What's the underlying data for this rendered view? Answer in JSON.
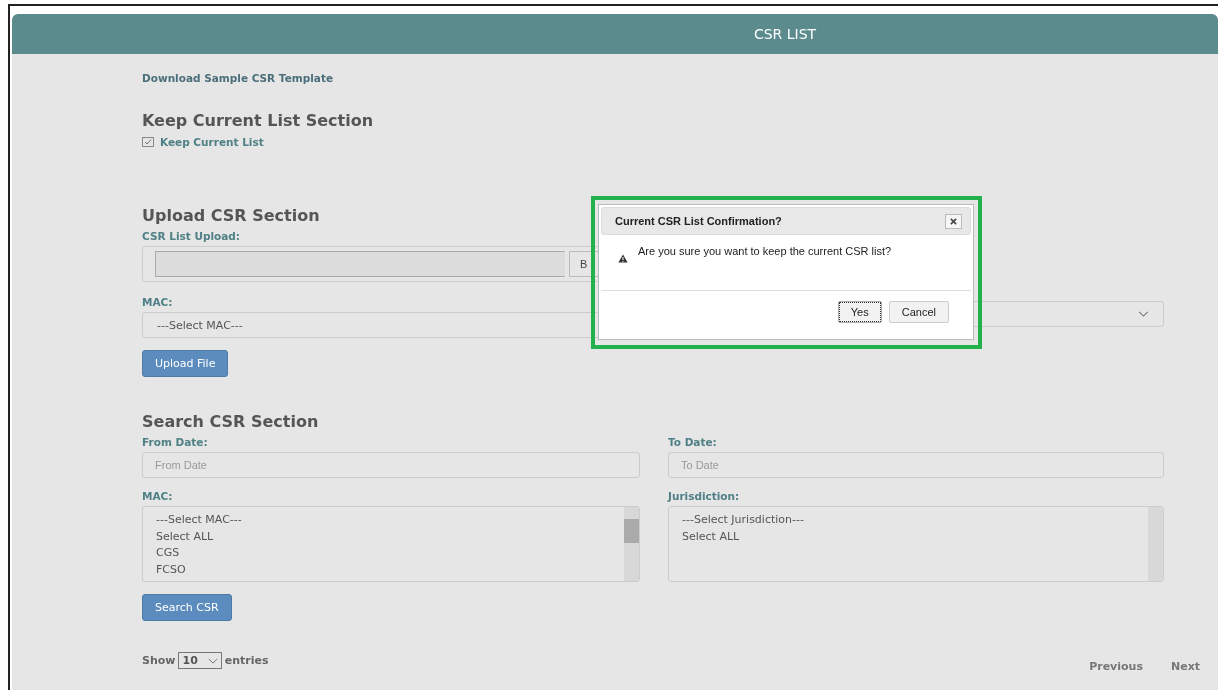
{
  "header": {
    "title": "CSR LIST"
  },
  "download_link": "Download Sample CSR Template",
  "keep_section": {
    "heading": "Keep Current List Section",
    "checkbox": {
      "label": "Keep Current List",
      "checked": true
    }
  },
  "upload_section": {
    "heading": "Upload CSR Section",
    "file_label": "CSR List Upload:",
    "browse_button": "B",
    "mac_label": "MAC:",
    "mac_select": "---Select MAC---",
    "upload_button": "Upload File"
  },
  "search_section": {
    "heading": "Search CSR Section",
    "from_label": "From Date:",
    "from_placeholder": "From Date",
    "to_label": "To Date:",
    "to_placeholder": "To Date",
    "mac_label": "MAC:",
    "mac_options": [
      "---Select MAC---",
      "Select ALL",
      "CGS",
      "FCSO"
    ],
    "jurisdiction_label": "Jurisdiction:",
    "jurisdiction_options": [
      "---Select Jurisdiction---",
      "Select ALL"
    ],
    "search_button": "Search CSR"
  },
  "table_controls": {
    "show": "Show",
    "page_size": "10",
    "entries": "entries",
    "previous": "Previous",
    "next": "Next"
  },
  "dialog": {
    "title": "Current CSR List Confirmation?",
    "message": "Are you sure you want to keep the current CSR list?",
    "buttons": [
      {
        "label": "Yes",
        "selected": true
      },
      {
        "label": "Cancel",
        "selected": false
      }
    ]
  }
}
